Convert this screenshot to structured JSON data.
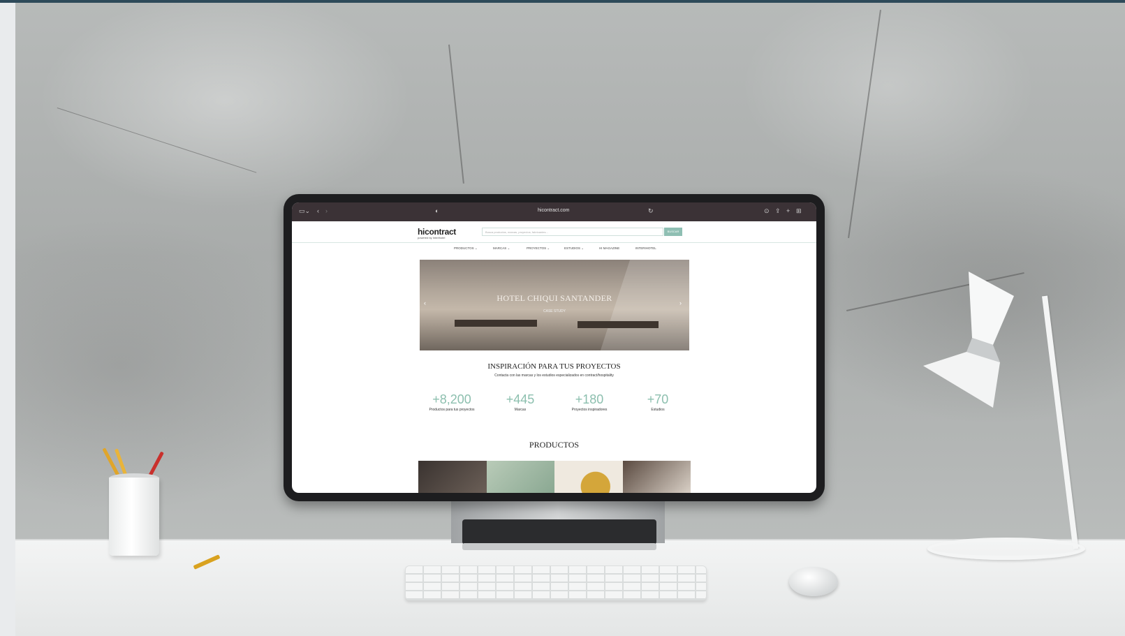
{
  "browser": {
    "url": "hicontract.com"
  },
  "site": {
    "logo": "hicontract",
    "logo_sub": "powered by Interihotel",
    "search_placeholder": "Busca productos, marcas, proyectos, fabricantes...",
    "search_button": "BUSCAR",
    "nav": [
      "PRODUCTOS ⌄",
      "MARCAS ⌄",
      "PROYECTOS ⌄",
      "ESTUDIOS ⌄",
      "HI MAGAZINE",
      "INTERIHOTEL"
    ],
    "hero": {
      "title": "HOTEL CHIQUI SANTANDER",
      "subtitle": "CASE STUDY"
    },
    "inspiration": {
      "title": "INSPIRACIÓN PARA TUS PROYECTOS",
      "subtitle": "Contacta con las marcas y los estudios especializados en contract/hospitality"
    },
    "stats": [
      {
        "value": "+8,200",
        "label": "Productos para tus proyectos"
      },
      {
        "value": "+445",
        "label": "Marcas"
      },
      {
        "value": "+180",
        "label": "Proyectos inspiradores"
      },
      {
        "value": "+70",
        "label": "Estudios"
      }
    ],
    "products_title": "PRODUCTOS"
  },
  "colors": {
    "accent": "#8cbfae",
    "topbar": "#2e4a5a",
    "browser_chrome": "#3b3236"
  }
}
